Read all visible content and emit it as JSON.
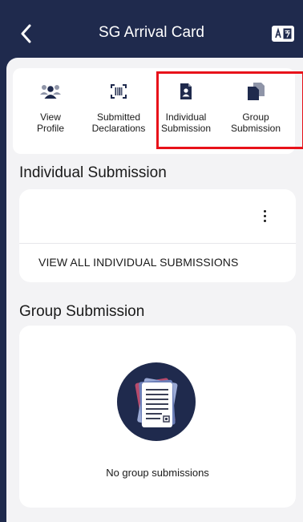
{
  "header": {
    "title": "SG Arrival Card",
    "back_icon": "chevron-left-icon",
    "language_icon": "translate-icon"
  },
  "quick_actions": [
    {
      "label": "View\nProfile",
      "icon": "people-icon"
    },
    {
      "label": "Submitted\nDeclarations",
      "icon": "barcode-scan-icon"
    },
    {
      "label": "Individual\nSubmission",
      "icon": "person-document-icon"
    },
    {
      "label": "Group\nSubmission",
      "icon": "documents-stack-icon"
    }
  ],
  "individual": {
    "section_title": "Individual Submission",
    "more_icon": "more-vertical-icon",
    "view_all": "VIEW ALL INDIVIDUAL SUBMISSIONS"
  },
  "group": {
    "section_title": "Group Submission",
    "empty_text": "No group submissions",
    "illustration": "stacked-documents-illustration"
  },
  "colors": {
    "header_bg": "#1f2a4d",
    "page_bg": "#f3f3f5",
    "highlight": "#e8121a",
    "illustration_bg": "#1f2a4d"
  }
}
